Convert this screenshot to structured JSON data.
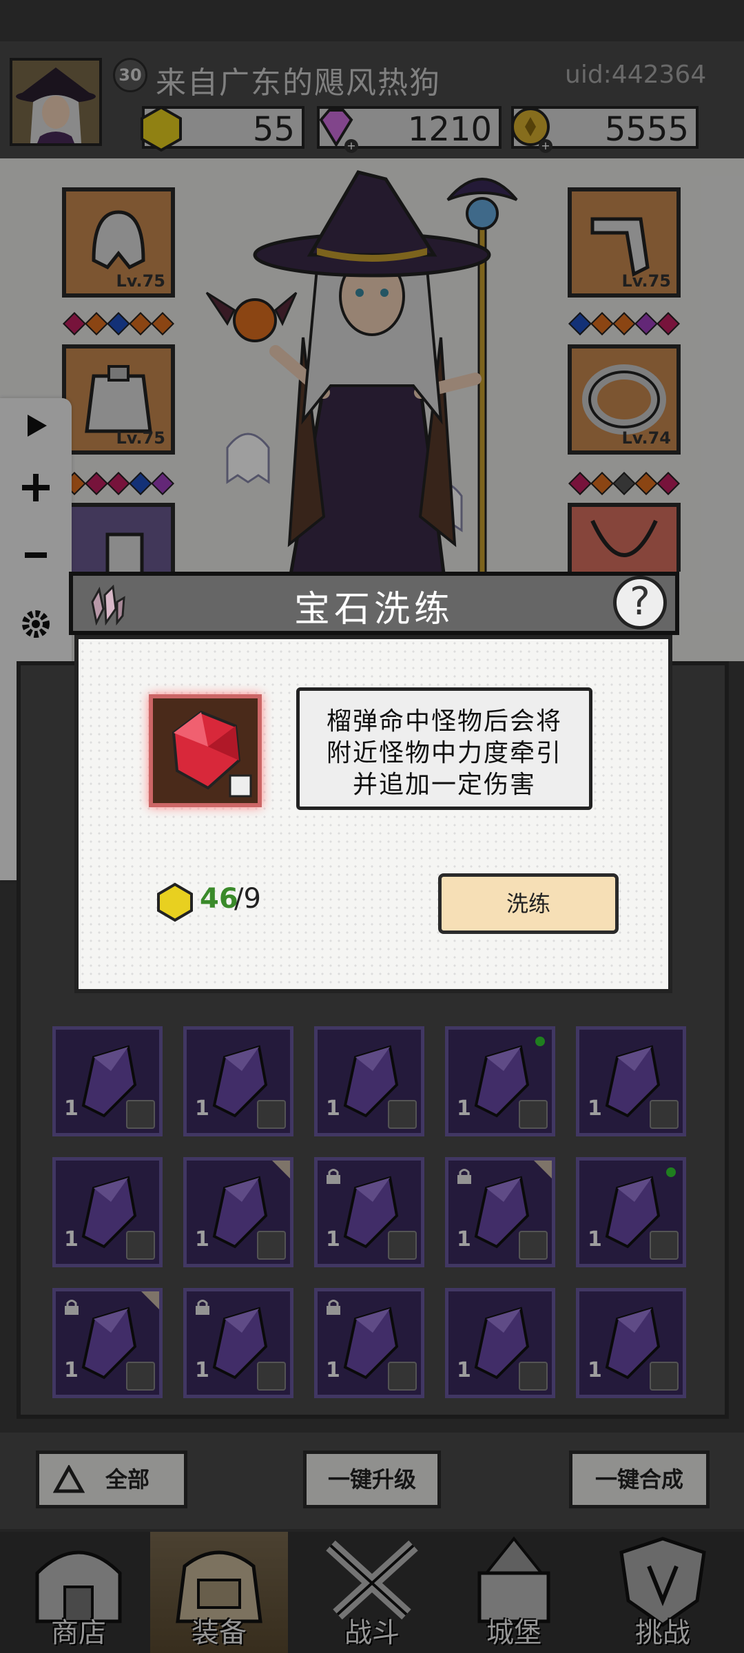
{
  "player": {
    "level": "30",
    "name": "来自广东的飓风热狗",
    "uid": "uid:442364"
  },
  "currencies": [
    {
      "name": "gold-crystal",
      "value": "55",
      "color": "#e8d020"
    },
    {
      "name": "diamond",
      "value": "1210",
      "color": "#d070e0"
    },
    {
      "name": "coin",
      "value": "5555",
      "color": "#d8b030"
    }
  ],
  "equipment": {
    "left": [
      {
        "slot": "helmet",
        "level": "Lv.75",
        "gems": [
          "#c02060",
          "#e07020",
          "#2050c0",
          "#e07020",
          "#e07020"
        ]
      },
      {
        "slot": "armor",
        "level": "Lv.75",
        "gems": [
          "#e07020",
          "#c02060",
          "#c02060",
          "#2050c0",
          "#a040c0"
        ]
      },
      {
        "slot": "boots",
        "level": "",
        "gems": []
      }
    ],
    "right": [
      {
        "slot": "gloves",
        "level": "Lv.75",
        "gems": [
          "#2050c0",
          "#e07020",
          "#e07020",
          "#a040c0",
          "#c02060"
        ]
      },
      {
        "slot": "ring",
        "level": "Lv.74",
        "gems": [
          "#c02060",
          "#e07020",
          "#555555",
          "#e07020",
          "#c02060"
        ]
      },
      {
        "slot": "necklace",
        "level": "",
        "gems": []
      }
    ]
  },
  "tools": [
    "play-icon",
    "plus-icon",
    "minus-icon",
    "gear-icon",
    "eye-icon",
    "move-icon",
    "close-icon"
  ],
  "dialog": {
    "title": "宝石洗练",
    "help": "?",
    "description_lines": [
      "榴弹命中怪物后会将",
      "附近怪物中力度牵引",
      "并追加一定伤害"
    ],
    "cost_have": "46",
    "cost_need": "/9",
    "refine_label": "洗练"
  },
  "inventory": {
    "rows": [
      [
        {
          "qty": "1",
          "lock": false,
          "dot": false,
          "corner": false
        },
        {
          "qty": "1",
          "lock": false,
          "dot": false,
          "corner": false
        },
        {
          "qty": "1",
          "lock": false,
          "dot": false,
          "corner": false
        },
        {
          "qty": "1",
          "lock": false,
          "dot": true,
          "corner": false
        },
        {
          "qty": "1",
          "lock": false,
          "dot": false,
          "corner": false
        }
      ],
      [
        {
          "qty": "1",
          "lock": false,
          "dot": false,
          "corner": false
        },
        {
          "qty": "1",
          "lock": false,
          "dot": false,
          "corner": true
        },
        {
          "qty": "1",
          "lock": true,
          "dot": false,
          "corner": false
        },
        {
          "qty": "1",
          "lock": true,
          "dot": false,
          "corner": true
        },
        {
          "qty": "1",
          "lock": false,
          "dot": true,
          "corner": false
        }
      ],
      [
        {
          "qty": "1",
          "lock": true,
          "dot": false,
          "corner": true
        },
        {
          "qty": "1",
          "lock": true,
          "dot": false,
          "corner": false
        },
        {
          "qty": "1",
          "lock": true,
          "dot": false,
          "corner": false
        },
        {
          "qty": "1",
          "lock": false,
          "dot": false,
          "corner": false
        },
        {
          "qty": "1",
          "lock": false,
          "dot": false,
          "corner": false
        }
      ]
    ]
  },
  "actions": {
    "filter_all": "全部",
    "upgrade_all": "一键升级",
    "merge_all": "一键合成"
  },
  "nav": [
    {
      "id": "shop",
      "label": "商店"
    },
    {
      "id": "equip",
      "label": "装备"
    },
    {
      "id": "battle",
      "label": "战斗"
    },
    {
      "id": "castle",
      "label": "城堡"
    },
    {
      "id": "challenge",
      "label": "挑战"
    }
  ]
}
